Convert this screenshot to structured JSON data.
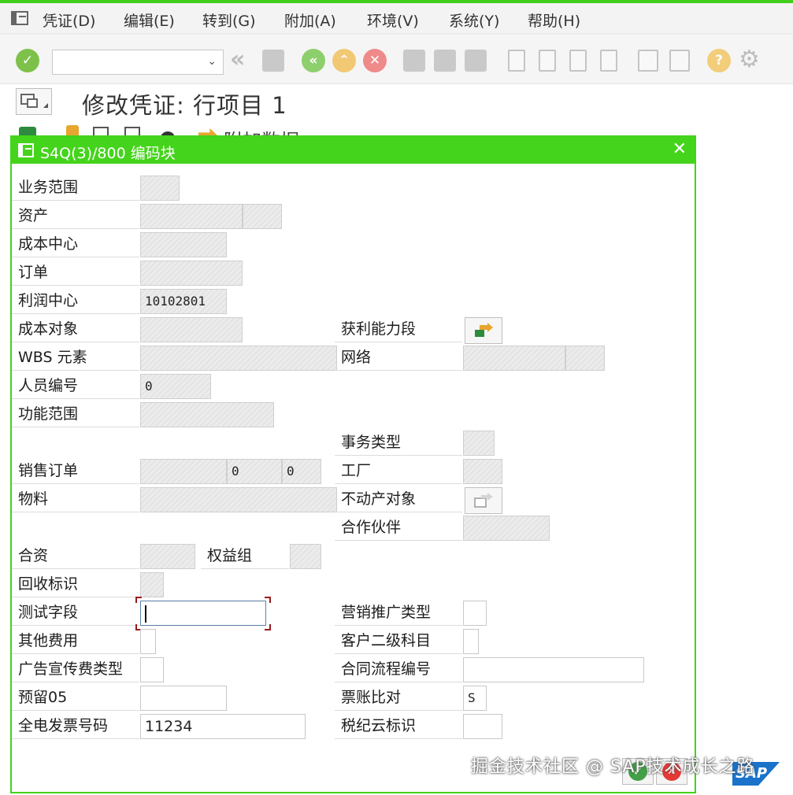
{
  "menu": {
    "items": [
      "凭证(D)",
      "编辑(E)",
      "转到(G)",
      "附加(A)",
      "环境(V)",
      "系统(Y)",
      "帮助(H)"
    ]
  },
  "icons": [
    "menu-icon",
    "enter-icon",
    "dropdown-chevron-icon",
    "back-double-icon",
    "save-icon",
    "back-icon",
    "exit-icon",
    "cancel-icon",
    "print-icon",
    "find-icon",
    "find-next-icon",
    "first-page-icon",
    "previous-page-icon",
    "next-page-icon",
    "last-page-icon",
    "create-session-icon",
    "shortcut-icon",
    "help-icon",
    "settings-icon"
  ],
  "colors": {
    "accent_green": "#45d41c",
    "cancel_red": "#e53935",
    "confirm_green": "#43a047",
    "sap_blue": "#1b72c9"
  },
  "page": {
    "title": "修改凭证: 行项目 1",
    "subtoolbar_text": "附加数据"
  },
  "dialog": {
    "title": "S4Q(3)/800 编码块",
    "fields": {
      "business_area": {
        "label": "业务范围",
        "value": ""
      },
      "asset": {
        "label": "资产",
        "value": ""
      },
      "cost_center": {
        "label": "成本中心",
        "value": ""
      },
      "order": {
        "label": "订单",
        "value": ""
      },
      "profit_center": {
        "label": "利润中心",
        "value": "10102801"
      },
      "cost_object": {
        "label": "成本对象",
        "value": ""
      },
      "profitability_segment": {
        "label": "获利能力段"
      },
      "wbs_element": {
        "label": "WBS 元素",
        "value": ""
      },
      "network": {
        "label": "网络",
        "value": ""
      },
      "personnel_number": {
        "label": "人员编号",
        "value": "0"
      },
      "functional_area": {
        "label": "功能范围",
        "value": ""
      },
      "transaction_type": {
        "label": "事务类型",
        "value": ""
      },
      "sales_order": {
        "label": "销售订单",
        "value": "",
        "item": "0",
        "schedule": "0"
      },
      "plant": {
        "label": "工厂",
        "value": ""
      },
      "material": {
        "label": "物料",
        "value": ""
      },
      "real_estate_object": {
        "label": "不动产对象"
      },
      "partner": {
        "label": "合作伙伴",
        "value": ""
      },
      "joint_venture": {
        "label": "合资",
        "value": ""
      },
      "equity_group": {
        "label": "权益组",
        "value": ""
      },
      "recovery_indicator": {
        "label": "回收标识",
        "value": ""
      },
      "test_field": {
        "label": "测试字段",
        "value": ""
      },
      "marketing_type": {
        "label": "营销推广类型",
        "value": ""
      },
      "other_expense": {
        "label": "其他费用",
        "value": ""
      },
      "customer_sub_account": {
        "label": "客户二级科目",
        "value": ""
      },
      "advertising_type": {
        "label": "广告宣传费类型",
        "value": ""
      },
      "contract_flow_number": {
        "label": "合同流程编号",
        "value": ""
      },
      "reserved_05": {
        "label": "预留05",
        "value": ""
      },
      "invoice_match": {
        "label": "票账比对",
        "value": "S"
      },
      "e_invoice_number": {
        "label": "全电发票号码",
        "value": "11234"
      },
      "tax_cloud_flag": {
        "label": "税纪云标识",
        "value": ""
      }
    }
  },
  "watermark": "掘金技术社区 @ SAP技术成长之路",
  "logo": "SAP"
}
